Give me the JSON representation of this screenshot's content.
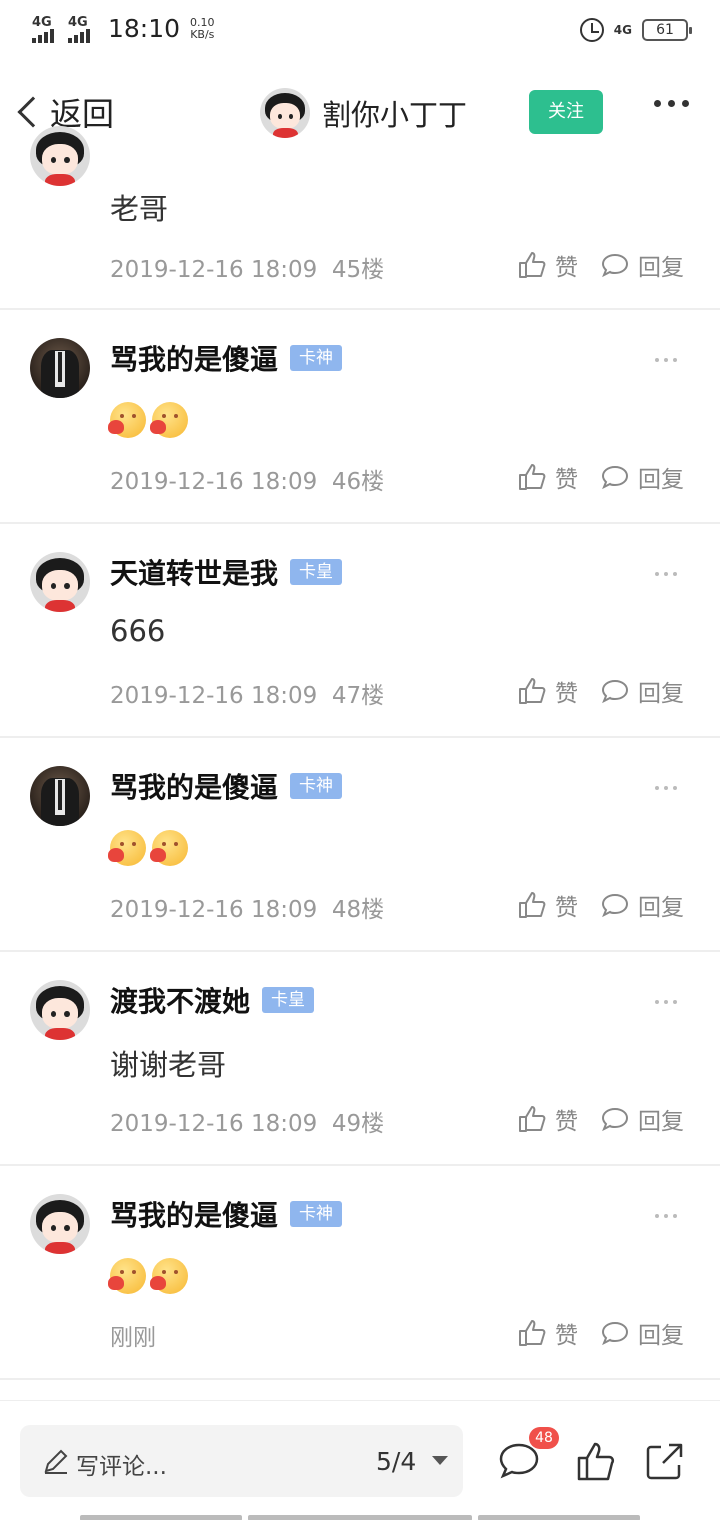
{
  "status_bar": {
    "sim1": "4G",
    "sim2": "4G",
    "time": "18:10",
    "speed_value": "0.10",
    "speed_unit": "KB/s",
    "network": "4G",
    "battery": "61"
  },
  "nav": {
    "back_label": "返回",
    "title": "割你小丁丁",
    "follow_label": "关注"
  },
  "posts": [
    {
      "content": "老哥",
      "time": "2019-12-16 18:09",
      "floor": "45楼",
      "like": "赞",
      "reply": "回复"
    },
    {
      "username": "骂我的是傻逼",
      "badge": "卡神",
      "emoji_count": 2,
      "time": "2019-12-16 18:09",
      "floor": "46楼",
      "like": "赞",
      "reply": "回复"
    },
    {
      "username": "天道转世是我",
      "badge": "卡皇",
      "content": "666",
      "time": "2019-12-16 18:09",
      "floor": "47楼",
      "like": "赞",
      "reply": "回复"
    },
    {
      "username": "骂我的是傻逼",
      "badge": "卡神",
      "emoji_count": 2,
      "time": "2019-12-16 18:09",
      "floor": "48楼",
      "like": "赞",
      "reply": "回复"
    },
    {
      "username": "渡我不渡她",
      "badge": "卡皇",
      "content": "谢谢老哥",
      "time": "2019-12-16 18:09",
      "floor": "49楼",
      "like": "赞",
      "reply": "回复"
    },
    {
      "username": "骂我的是傻逼",
      "badge": "卡神",
      "emoji_count": 2,
      "time": "刚刚",
      "like": "赞",
      "reply": "回复"
    }
  ],
  "bottom_bar": {
    "comment_placeholder": "写评论...",
    "page_indicator": "5/4",
    "comment_count": "48"
  },
  "colors": {
    "follow_button": "#2dbf8f",
    "badge": "#8fb6ee",
    "count_badge": "#f0504a",
    "meta_text": "#999999"
  }
}
